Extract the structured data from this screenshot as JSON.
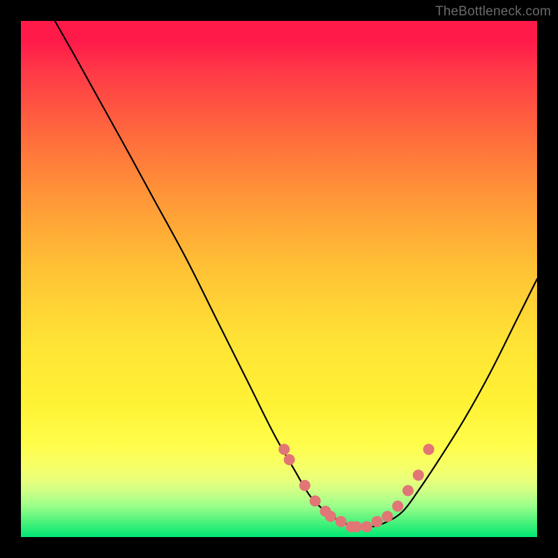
{
  "attribution": "TheBottleneck.com",
  "colors": {
    "background": "#000000",
    "curve": "#000000",
    "marker_fill": "#e27575",
    "marker_stroke": "#e27575",
    "gradient_stops": [
      "#ff1a4a",
      "#ff6a3d",
      "#ffc235",
      "#fff235",
      "#9aff8a",
      "#00e874"
    ]
  },
  "chart_data": {
    "type": "line",
    "title": "",
    "xlabel": "",
    "ylabel": "",
    "xlim": [
      0,
      100
    ],
    "ylim": [
      0,
      100
    ],
    "x": [
      0,
      3,
      6,
      10,
      15,
      20,
      26,
      32,
      38,
      44,
      49,
      53,
      56,
      59,
      62,
      65,
      68,
      71,
      74,
      77,
      81,
      86,
      91,
      96,
      100
    ],
    "values": [
      109,
      106,
      101,
      94,
      85,
      76,
      65,
      54,
      42,
      30,
      20,
      13,
      8,
      5,
      3,
      2,
      2,
      3,
      5,
      9,
      15,
      23,
      32,
      42,
      50
    ],
    "markers_x": [
      51,
      52,
      55,
      57,
      59,
      60,
      62,
      64,
      65,
      67,
      69,
      71,
      73,
      75,
      77,
      79
    ],
    "markers_y": [
      17,
      15,
      10,
      7,
      5,
      4,
      3,
      2,
      2,
      2,
      3,
      4,
      6,
      9,
      12,
      17
    ],
    "grid": false,
    "legend": false
  }
}
